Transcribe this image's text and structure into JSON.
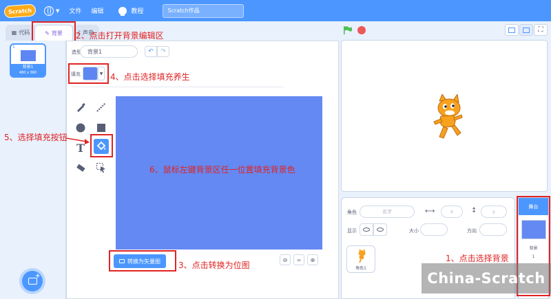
{
  "menubar": {
    "logo": "Scratch",
    "file": "文件",
    "edit": "编辑",
    "tutorials": "教程",
    "project_title": "Scratch作品"
  },
  "tabs": {
    "code": "代码",
    "backdrops": "背景",
    "sounds": "声音"
  },
  "costume_list": {
    "items": [
      {
        "number": "1",
        "name": "背景1",
        "size": "480 x 360"
      }
    ]
  },
  "editor": {
    "backdrop_label": "造型",
    "backdrop_name": "背景1",
    "fill_label": "填充",
    "fill_color": "#5e86f3",
    "convert_button": "转换为矢量图"
  },
  "sprite_info": {
    "sprite_label": "角色",
    "sprite_placeholder": "名字",
    "x_placeholder": "x",
    "y_placeholder": "y",
    "show_label": "显示",
    "size_label": "大小",
    "direction_label": "方向",
    "sprite_tile_name": "角色1"
  },
  "stage_target": {
    "header": "舞台",
    "backdrops_label": "背景",
    "backdrops_count": "1"
  },
  "annotations": {
    "a1": "1、点击选择背景",
    "a2": "2、点击打开背景编辑区",
    "a3": "3、点击转换为位图",
    "a4": "4、点击选择填充养生",
    "a5": "5、选择填充按钮",
    "a6": "6、鼠标左键背景区任一位置填充背景色"
  },
  "watermark": "China-Scratch",
  "colors": {
    "brand": "#4c97ff",
    "canvas_fill": "#6489f2",
    "annotation": "#e02323"
  }
}
